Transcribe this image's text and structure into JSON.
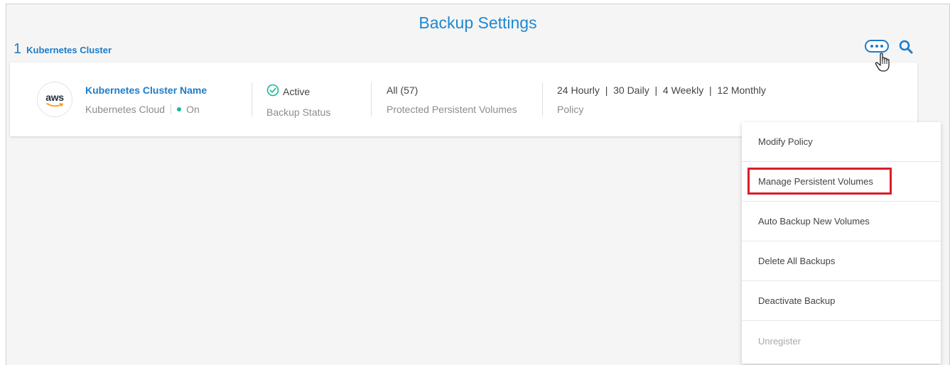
{
  "page": {
    "title": "Backup Settings",
    "cluster_count": "1",
    "cluster_count_label": "Kubernetes Cluster"
  },
  "cluster": {
    "provider_logo_text": "aws",
    "name": "Kubernetes Cluster Name",
    "cloud": "Kubernetes Cloud",
    "state": "On",
    "status_value": "Active",
    "status_label": "Backup Status",
    "volumes_value": "All (57)",
    "volumes_label": "Protected Persistent Volumes",
    "policy_value": "24 Hourly  |  30 Daily  |  4 Weekly  |  12 Monthly",
    "policy_label": "Policy"
  },
  "menu": {
    "items": [
      {
        "label": "Modify Policy",
        "enabled": true
      },
      {
        "label": "Manage Persistent Volumes",
        "enabled": true,
        "highlighted": true
      },
      {
        "label": "Auto Backup New Volumes",
        "enabled": true
      },
      {
        "label": "Delete All Backups",
        "enabled": true
      },
      {
        "label": "Deactivate Backup",
        "enabled": true
      },
      {
        "label": "Unregister",
        "enabled": false
      }
    ]
  },
  "colors": {
    "accent": "#1e7cc6",
    "title": "#1e88d2",
    "status_on": "#17b897",
    "highlight_box": "#d81e2a"
  },
  "icons": {
    "search": "search-icon",
    "status": "check-circle-icon",
    "more": "more-options-icon",
    "cursor": "hand-pointer-icon"
  }
}
